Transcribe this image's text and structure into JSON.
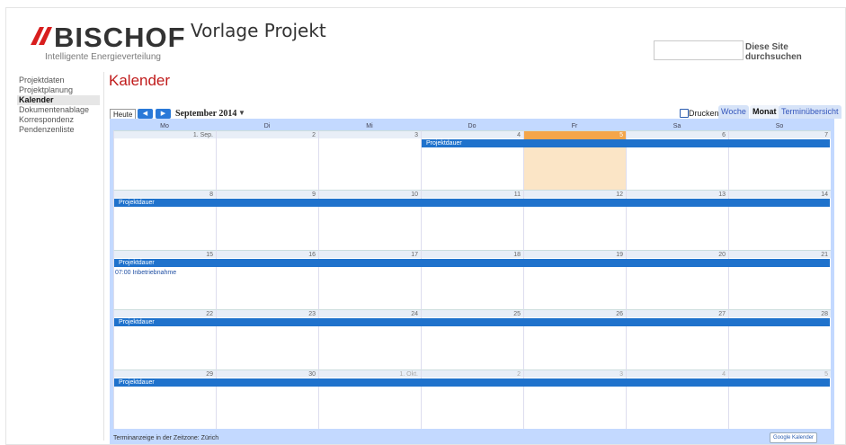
{
  "header": {
    "logo_text": "BISCHOF",
    "logo_tagline": "Intelligente Energieverteilung",
    "site_title": "Vorlage Projekt",
    "search_placeholder": "",
    "search_button": "Diese Site durchsuchen"
  },
  "nav": {
    "items": [
      {
        "label": "Projektdaten",
        "selected": false
      },
      {
        "label": "Projektplanung",
        "selected": false
      },
      {
        "label": "Kalender",
        "selected": true
      },
      {
        "label": "Dokumentenablage",
        "selected": false
      },
      {
        "label": "Korrespondenz",
        "selected": false
      },
      {
        "label": "Pendenzenliste",
        "selected": false
      }
    ]
  },
  "page": {
    "heading": "Kalender"
  },
  "toolbar": {
    "today": "Heute",
    "prev_icon": "chevron-left-icon",
    "next_icon": "chevron-right-icon",
    "month": "September 2014",
    "dropdown": "▼",
    "print": "Drucken",
    "tabs": [
      {
        "label": "Woche",
        "active": false
      },
      {
        "label": "Monat",
        "active": true
      },
      {
        "label": "Terminübersicht",
        "active": false
      }
    ]
  },
  "calendar": {
    "weekdays": [
      "Mo",
      "Di",
      "Mi",
      "Do",
      "Fr",
      "Sa",
      "So"
    ],
    "today_day": "5",
    "weeks": [
      {
        "days": [
          "1. Sep.",
          "2",
          "3",
          "4",
          "5",
          "6",
          "7"
        ]
      },
      {
        "days": [
          "8",
          "9",
          "10",
          "11",
          "12",
          "13",
          "14"
        ]
      },
      {
        "days": [
          "15",
          "16",
          "17",
          "18",
          "19",
          "20",
          "21"
        ]
      },
      {
        "days": [
          "22",
          "23",
          "24",
          "25",
          "26",
          "27",
          "28"
        ]
      },
      {
        "days": [
          "29",
          "30",
          "1. Okt.",
          "2",
          "3",
          "4",
          "5"
        ]
      }
    ],
    "event_label": "Projektdauer",
    "timed_event": "07:00 Inbetriebnahme",
    "timezone_note": "Terminanzeige in der Zeitzone: Zürich",
    "gcal_badge": "Google Kalender"
  },
  "colors": {
    "accent_red": "#c01b1b",
    "event_blue": "#1f72cc",
    "grid_blue": "#c3d9ff",
    "today_orange": "#f4a64a"
  }
}
